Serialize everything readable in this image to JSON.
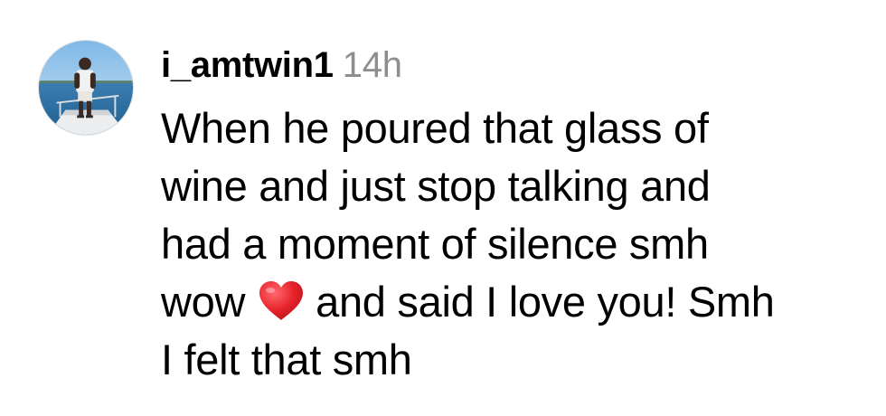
{
  "comment": {
    "username": "i_amtwin1",
    "timestamp": "14h",
    "text_lines": [
      "When he poured that glass of",
      "wine and just stop talking and",
      "had a moment of silence smh",
      "wow",
      "and said I love you! Smh",
      "I felt that smh"
    ],
    "emoji": "red-heart-icon",
    "avatar_icon": "profile-avatar"
  },
  "colors": {
    "timestamp": "#8e8e8e",
    "heart": "#e8232b",
    "text": "#000000"
  }
}
